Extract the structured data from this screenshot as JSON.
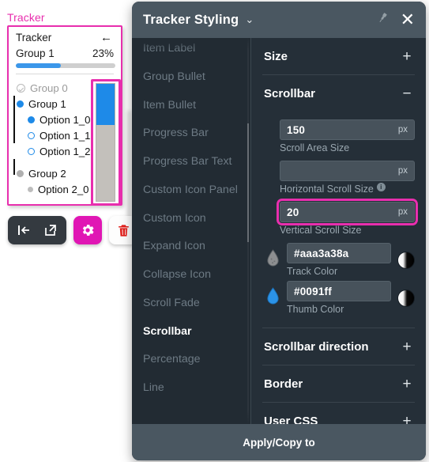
{
  "tracker": {
    "panel_title": "Tracker",
    "card": {
      "title": "Tracker",
      "back_icon": "←",
      "group_label": "Group 1",
      "percent_label": "23%",
      "progress_fill_percent": 45,
      "items": [
        {
          "label": "Group 0",
          "bullet": "check-circle",
          "muted": true,
          "indent": 0
        },
        {
          "label": "Group 1",
          "bullet": "filled-blue",
          "muted": false,
          "indent": 0
        },
        {
          "label": "Option 1_0",
          "bullet": "filled-blue",
          "muted": false,
          "indent": 1
        },
        {
          "label": "Option 1_1",
          "bullet": "hollow-blue",
          "muted": false,
          "indent": 1
        },
        {
          "label": "Option 1_2",
          "bullet": "hollow-blue",
          "muted": false,
          "indent": 1
        },
        {
          "label": "Group 2",
          "bullet": "filled-gray",
          "muted": false,
          "indent": 0
        },
        {
          "label": "Option 2_0",
          "bullet": "small-gray",
          "muted": false,
          "indent": 1
        }
      ],
      "scrollbar": {
        "thumb_color": "#1e8ae8",
        "track_color": "#c3c0bb",
        "thumb_percent": 35,
        "highlight_color": "#e82fae"
      }
    },
    "toolbar": {
      "collapse_label": "collapse-panel",
      "popout_label": "open-in-new",
      "settings_label": "settings",
      "delete_label": "delete",
      "settings_color": "#e016b4"
    }
  },
  "dialog": {
    "title": "Tracker Styling",
    "caret": "⌄",
    "pin_label": "pin",
    "close_label": "✕",
    "sidebar": [
      {
        "label": "Item Label",
        "active": false
      },
      {
        "label": "Group Bullet",
        "active": false
      },
      {
        "label": "Item Bullet",
        "active": false
      },
      {
        "label": "Progress Bar",
        "active": false
      },
      {
        "label": "Progress Bar Text",
        "active": false
      },
      {
        "label": "Custom Icon Panel",
        "active": false
      },
      {
        "label": "Custom Icon",
        "active": false
      },
      {
        "label": "Expand Icon",
        "active": false
      },
      {
        "label": "Collapse Icon",
        "active": false
      },
      {
        "label": "Scroll Fade",
        "active": false
      },
      {
        "label": "Scrollbar",
        "active": true
      },
      {
        "label": "Percentage",
        "active": false
      },
      {
        "label": "Line",
        "active": false
      }
    ],
    "sections": [
      {
        "title": "Size",
        "toggle": "+",
        "expanded": false
      },
      {
        "title": "Scrollbar",
        "toggle": "−",
        "expanded": true
      },
      {
        "title": "Scrollbar direction",
        "toggle": "+",
        "expanded": false
      },
      {
        "title": "Border",
        "toggle": "+",
        "expanded": false
      },
      {
        "title": "User CSS",
        "toggle": "+",
        "expanded": false
      }
    ],
    "scrollbar_fields": {
      "scroll_area_size": {
        "value": "150",
        "unit": "px",
        "label": "Scroll Area Size",
        "info": false,
        "highlight": false
      },
      "horizontal_scroll_size": {
        "value": "",
        "unit": "px",
        "label": "Horizontal Scroll Size",
        "info": true,
        "info_glyph": "i",
        "highlight": false
      },
      "vertical_scroll_size": {
        "value": "20",
        "unit": "px",
        "label": "Vertical Scroll Size",
        "info": false,
        "highlight": true
      },
      "track_color": {
        "value": "#aaa3a38a",
        "label": "Track Color",
        "droplet": "#8d8f91"
      },
      "thumb_color": {
        "value": "#0091ff",
        "label": "Thumb Color",
        "droplet": "#2b93e8"
      }
    },
    "footer": {
      "label": "Apply/Copy to"
    }
  }
}
